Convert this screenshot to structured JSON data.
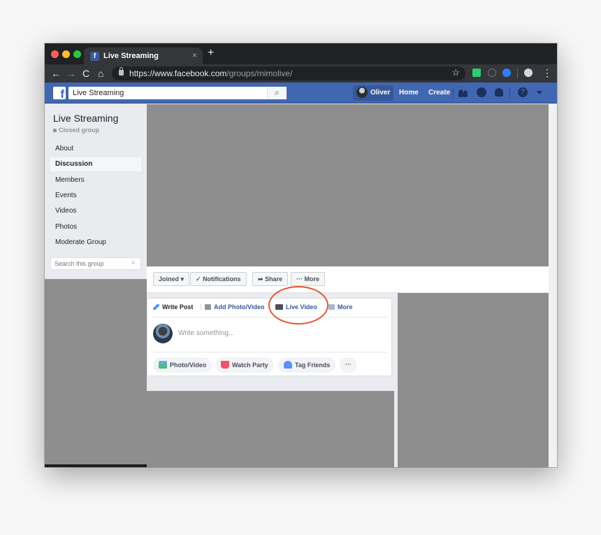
{
  "browser": {
    "tab_title": "Live Streaming",
    "tab_close": "×",
    "new_tab": "+",
    "url_host": "https://www.facebook.com",
    "url_path": "/groups/mimolive/",
    "star": "☆",
    "kebab": "⋮",
    "back": "←",
    "forward": "→",
    "reload": "C",
    "home": "⌂"
  },
  "fb": {
    "logo": "f",
    "search_value": "Live Streaming",
    "search_icon": "⌕",
    "user_name": "Oliver",
    "home": "Home",
    "create": "Create",
    "help": "?"
  },
  "group": {
    "name": "Live Streaming",
    "privacy": "Closed group",
    "nav": [
      "About",
      "Discussion",
      "Members",
      "Events",
      "Videos",
      "Photos",
      "Moderate Group"
    ],
    "active_nav": "Discussion",
    "search_placeholder": "Search this group",
    "search_icon": "⌕"
  },
  "actions": {
    "joined": "Joined ▾",
    "notifications_check": "✓",
    "notifications": "Notifications",
    "share_arrow": "➦",
    "share": "Share",
    "more_dots": "···",
    "more": "More"
  },
  "composer": {
    "tabs": {
      "write_post": "Write Post",
      "add_photo_video": "Add Photo/Video",
      "live_video": "Live Video",
      "more": "More"
    },
    "placeholder": "Write something...",
    "pills": {
      "photo_video": "Photo/Video",
      "watch_party": "Watch Party",
      "tag_friends": "Tag Friends",
      "more": "···"
    }
  },
  "colors": {
    "fb_blue": "#4267b2",
    "highlight_circle": "#e4572e",
    "redacted_gray": "#8e8e8e"
  }
}
